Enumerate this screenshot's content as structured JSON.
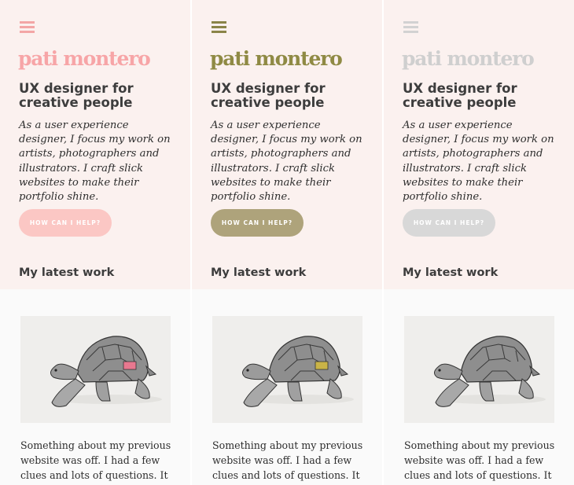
{
  "columns": [
    {
      "logo": "pati montero",
      "headline": "UX designer for creative people",
      "intro": "As a user experience designer, I focus my work on artists, photographers and illustrators. I craft slick websites to make their portfolio shine.",
      "cta_label": "HOW CAN I HELP?",
      "section_title": "My latest work",
      "work_excerpt": "Something about my previous website was off. I had a few clues and lots of questions. It wasn't until I",
      "colors": {
        "accent": "#f7a5a7",
        "menu": "#f3a6a6",
        "button": "#fbc7c4",
        "drawer": "#e8788f"
      }
    },
    {
      "logo": "pati montero",
      "headline": "UX designer for creative people",
      "intro": "As a user experience designer, I focus my work on artists, photographers and illustrators. I craft slick websites to make their portfolio shine.",
      "cta_label": "HOW CAN I HELP?",
      "section_title": "My latest work",
      "work_excerpt": "Something about my previous website was off. I had a few clues and lots of questions. It wasn't until I",
      "colors": {
        "accent": "#8f8a44",
        "menu": "#8a8448",
        "button": "#aea37b",
        "drawer": "#c9b347"
      }
    },
    {
      "logo": "pati montero",
      "headline": "UX designer for creative people",
      "intro": "As a user experience designer, I focus my work on artists, photographers and illustrators. I craft slick websites to make their portfolio shine.",
      "cta_label": "HOW CAN I HELP?",
      "section_title": "My latest work",
      "work_excerpt": "Something about my previous website was off. I had a few clues and lots of questions. It wasn't until I",
      "colors": {
        "accent": "#cfcfcf",
        "menu": "#d2d2d2",
        "button": "#d8d8d8",
        "drawer": ""
      }
    }
  ],
  "icons": {
    "menu": "hamburger-icon",
    "image": "tortoise-illustration"
  }
}
